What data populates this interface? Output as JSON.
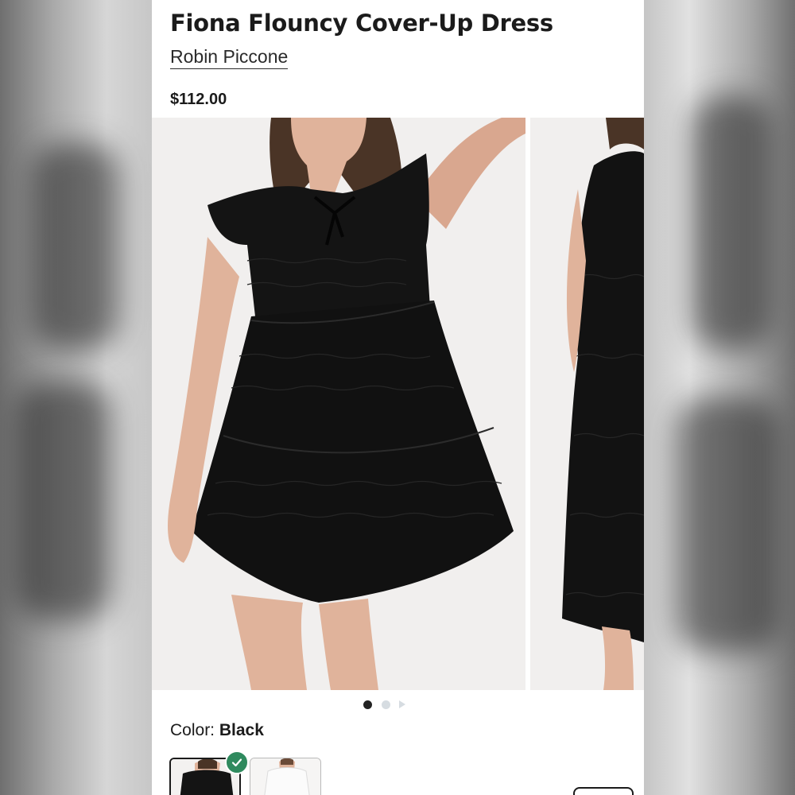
{
  "product": {
    "title": "Fiona Flouncy Cover-Up Dress",
    "brand": "Robin Piccone",
    "price": "$112.00"
  },
  "gallery": {
    "slide_count": 3,
    "active_index": 0,
    "images": [
      "model-front-black-dress",
      "model-side-black-dress"
    ]
  },
  "color": {
    "label": "Color:",
    "selected": "Black",
    "options": [
      "Black",
      "White"
    ]
  },
  "colors": {
    "text": "#1b1b1b",
    "check_badge": "#2f8a5e",
    "dot_active": "#222222",
    "dot_inactive": "#d6dce1"
  },
  "icons": {
    "selected_check": "check-icon",
    "carousel_next": "play-arrow-icon"
  }
}
